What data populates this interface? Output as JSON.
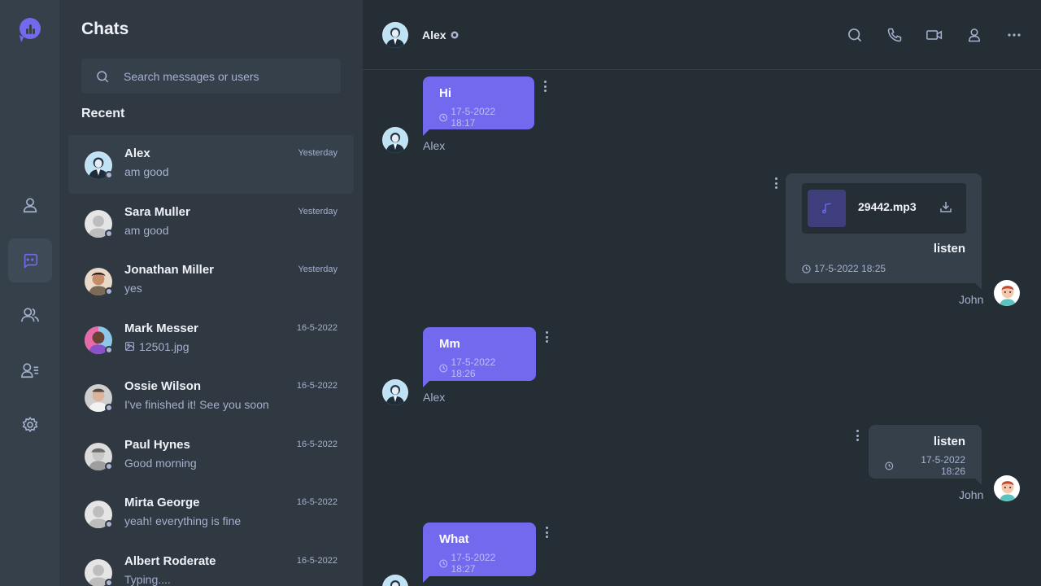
{
  "sidebar": {
    "nav": [
      "profile",
      "chats",
      "groups",
      "contacts",
      "settings"
    ],
    "active": "chats"
  },
  "chat_list": {
    "title": "Chats",
    "search_placeholder": "Search messages or users",
    "section_title": "Recent",
    "items": [
      {
        "name": "Alex",
        "message": "am good",
        "time": "Yesterday"
      },
      {
        "name": "Sara Muller",
        "message": "am good",
        "time": "Yesterday"
      },
      {
        "name": "Jonathan Miller",
        "message": "yes",
        "time": "Yesterday"
      },
      {
        "name": "Mark Messer",
        "message": "12501.jpg",
        "time": "16-5-2022"
      },
      {
        "name": "Ossie Wilson",
        "message": "I've finished it! See you soon",
        "time": "16-5-2022"
      },
      {
        "name": "Paul Hynes",
        "message": "Good morning",
        "time": "16-5-2022"
      },
      {
        "name": "Mirta George",
        "message": "yeah! everything is fine",
        "time": "16-5-2022"
      },
      {
        "name": "Albert Roderate",
        "message": "Typing....",
        "time": "16-5-2022"
      }
    ]
  },
  "conversation": {
    "contact_name": "Alex",
    "header_icons": [
      "search-icon",
      "phone-icon",
      "video-icon",
      "user-icon",
      "more-icon"
    ],
    "messages": [
      {
        "from": "Alex",
        "text": "Hi",
        "time": "17-5-2022 18:17"
      },
      {
        "from": "John",
        "file": "29442.mp3",
        "text": "listen",
        "time": "17-5-2022 18:25"
      },
      {
        "from": "Alex",
        "text": "Mm",
        "time": "17-5-2022 18:26"
      },
      {
        "from": "John",
        "text": "listen",
        "time": "17-5-2022 18:26"
      },
      {
        "from": "Alex",
        "text": "What",
        "time": "17-5-2022 18:27"
      }
    ]
  },
  "colors": {
    "accent": "#7269ef",
    "rail_bg": "#36404a",
    "list_bg": "#303841",
    "conv_bg": "#262e35",
    "muted_text": "#a6b0cf"
  }
}
